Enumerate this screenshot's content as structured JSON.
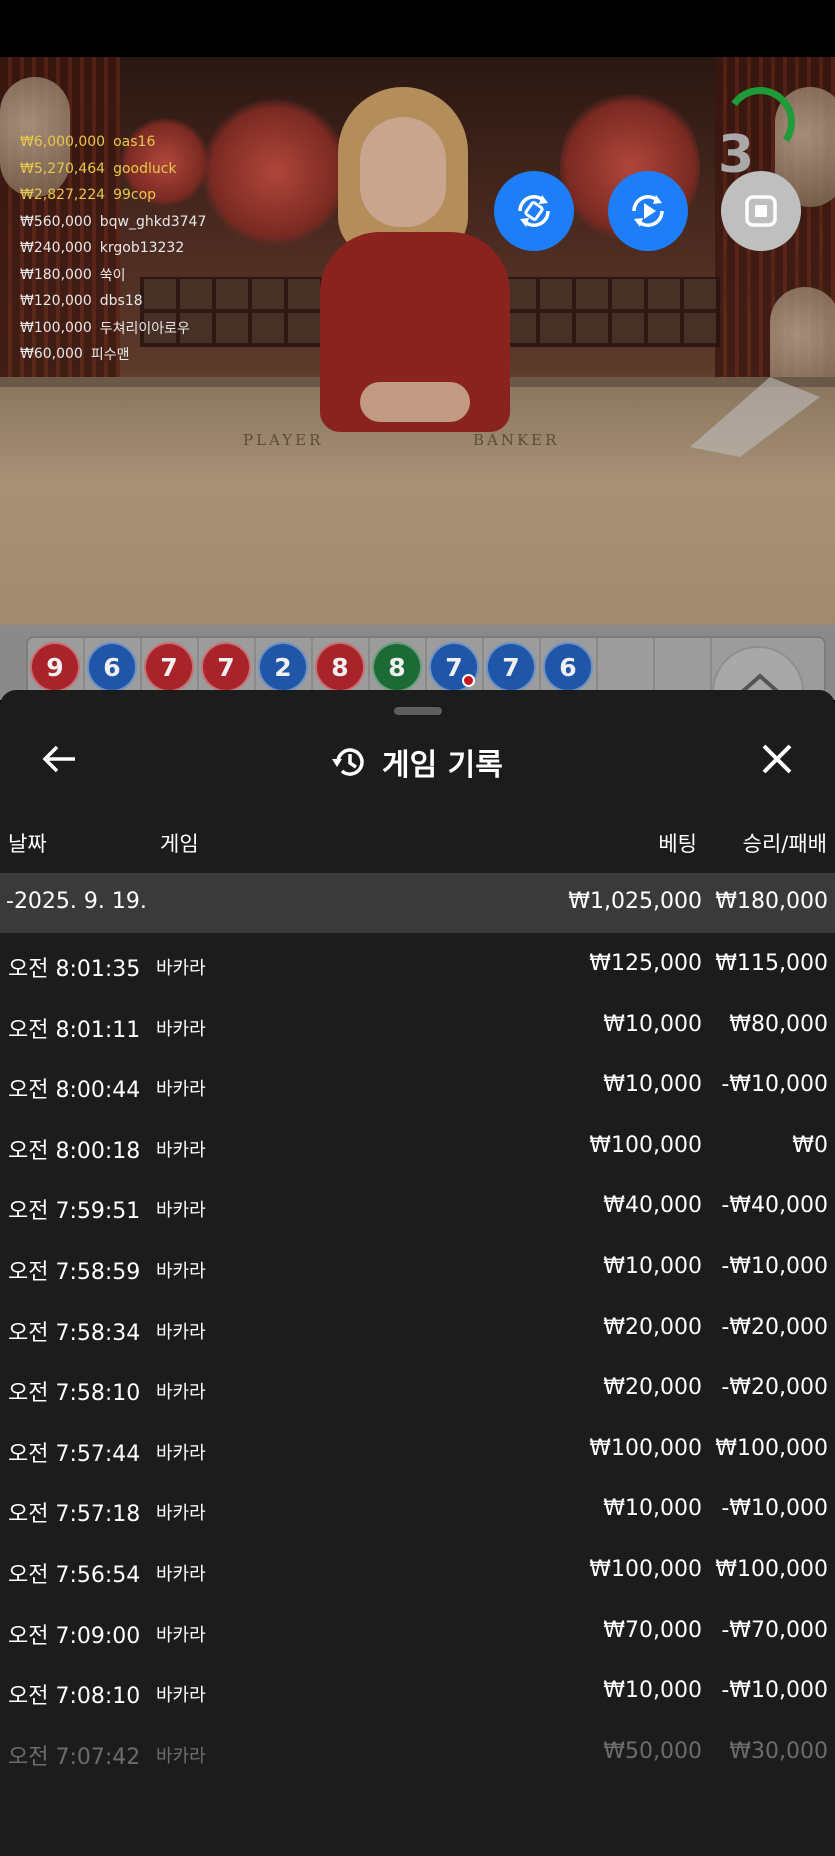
{
  "leaderboard": [
    {
      "amount": "₩6,000,000",
      "name": "oas16"
    },
    {
      "amount": "₩5,270,464",
      "name": "goodluck"
    },
    {
      "amount": "₩2,827,224",
      "name": "99cop"
    },
    {
      "amount": "₩560,000",
      "name": "bqw_ghkd3747"
    },
    {
      "amount": "₩240,000",
      "name": "krgob13232"
    },
    {
      "amount": "₩180,000",
      "name": "쑥이"
    },
    {
      "amount": "₩120,000",
      "name": "dbs18"
    },
    {
      "amount": "₩100,000",
      "name": "두쳐리이아로우"
    },
    {
      "amount": "₩60,000",
      "name": "피수맨"
    }
  ],
  "table_labels": {
    "player": "PLAYER",
    "banker": "BANKER"
  },
  "timer": "3",
  "bead_road": [
    {
      "value": "9",
      "color": "red"
    },
    {
      "value": "6",
      "color": "blue"
    },
    {
      "value": "7",
      "color": "red"
    },
    {
      "value": "7",
      "color": "red"
    },
    {
      "value": "2",
      "color": "blue"
    },
    {
      "value": "8",
      "color": "red"
    },
    {
      "value": "8",
      "color": "green"
    },
    {
      "value": "7",
      "color": "blue"
    },
    {
      "value": "7",
      "color": "blue"
    },
    {
      "value": "6",
      "color": "blue"
    }
  ],
  "sheet": {
    "title": "게임 기록",
    "columns": {
      "date": "날짜",
      "game": "게임",
      "bet": "베팅",
      "result": "승리/패배"
    },
    "day": {
      "date": "-2025. 9. 19.",
      "bet": "₩1,025,000",
      "result": "₩180,000"
    },
    "rows": [
      {
        "time": "오전 8:01:35",
        "game": "바카라",
        "bet": "₩125,000",
        "result": "₩115,000"
      },
      {
        "time": "오전 8:01:11",
        "game": "바카라",
        "bet": "₩10,000",
        "result": "₩80,000"
      },
      {
        "time": "오전 8:00:44",
        "game": "바카라",
        "bet": "₩10,000",
        "result": "-₩10,000"
      },
      {
        "time": "오전 8:00:18",
        "game": "바카라",
        "bet": "₩100,000",
        "result": "₩0"
      },
      {
        "time": "오전 7:59:51",
        "game": "바카라",
        "bet": "₩40,000",
        "result": "-₩40,000"
      },
      {
        "time": "오전 7:58:59",
        "game": "바카라",
        "bet": "₩10,000",
        "result": "-₩10,000"
      },
      {
        "time": "오전 7:58:34",
        "game": "바카라",
        "bet": "₩20,000",
        "result": "-₩20,000"
      },
      {
        "time": "오전 7:58:10",
        "game": "바카라",
        "bet": "₩20,000",
        "result": "-₩20,000"
      },
      {
        "time": "오전 7:57:44",
        "game": "바카라",
        "bet": "₩100,000",
        "result": "₩100,000"
      },
      {
        "time": "오전 7:57:18",
        "game": "바카라",
        "bet": "₩10,000",
        "result": "-₩10,000"
      },
      {
        "time": "오전 7:56:54",
        "game": "바카라",
        "bet": "₩100,000",
        "result": "₩100,000"
      },
      {
        "time": "오전 7:09:00",
        "game": "바카라",
        "bet": "₩70,000",
        "result": "-₩70,000"
      },
      {
        "time": "오전 7:08:10",
        "game": "바카라",
        "bet": "₩10,000",
        "result": "-₩10,000"
      },
      {
        "time": "오전 7:07:42",
        "game": "바카라",
        "bet": "₩50,000",
        "result": "₩30,000"
      }
    ]
  }
}
